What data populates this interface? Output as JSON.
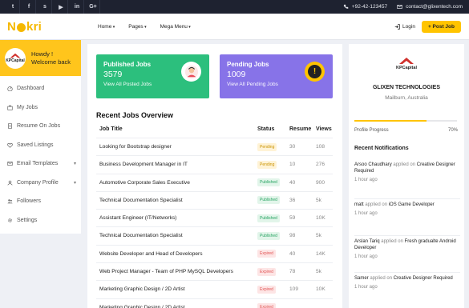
{
  "topbar": {
    "socials": [
      {
        "icon": "twitter-icon",
        "glyph": "t"
      },
      {
        "icon": "facebook-icon",
        "glyph": "f"
      },
      {
        "icon": "skype-icon",
        "glyph": "s"
      },
      {
        "icon": "youtube-icon",
        "glyph": "▶"
      },
      {
        "icon": "linkedin-icon",
        "glyph": "in"
      },
      {
        "icon": "google-plus-icon",
        "glyph": "G+"
      }
    ],
    "phone": "+92-42-123457",
    "email": "contact@glixentech.com"
  },
  "nav": {
    "logo": "Nokri",
    "menu": [
      "Home",
      "Pages",
      "Mega Menu"
    ],
    "login": "Login",
    "post_job": "+ Post Job"
  },
  "sidebar": {
    "greeting_line1": "Howdy !",
    "greeting_line2": "Welcome back",
    "avatar_text": "KPCapital",
    "items": [
      {
        "label": "Dashboard",
        "icon": "speedometer-icon",
        "chevron": ""
      },
      {
        "label": "My Jobs",
        "icon": "briefcase-icon",
        "chevron": ""
      },
      {
        "label": "Resume On Jobs",
        "icon": "document-icon",
        "chevron": ""
      },
      {
        "label": "Saved Listings",
        "icon": "heart-icon",
        "chevron": ""
      },
      {
        "label": "Email Templates",
        "icon": "mail-icon",
        "chevron": "▾"
      },
      {
        "label": "Company Profile",
        "icon": "user-icon",
        "chevron": "▾"
      },
      {
        "label": "Followers",
        "icon": "people-icon",
        "chevron": ""
      },
      {
        "label": "Settings",
        "icon": "gear-icon",
        "chevron": ""
      }
    ]
  },
  "cards": {
    "published": {
      "title": "Published Jobs",
      "value": "3579",
      "link": "View All Posted Jobs"
    },
    "pending": {
      "title": "Pending Jobs",
      "value": "1009",
      "link": "View All Pending Jobs"
    }
  },
  "overview": {
    "title": "Recent Jobs Overview",
    "headers": {
      "title": "Job Title",
      "status": "Status",
      "resume": "Resume",
      "views": "Views"
    },
    "rows": [
      {
        "title": "Looking for Bootstrap designer",
        "status": "Pending",
        "type": "pending",
        "resume": "30",
        "views": "108"
      },
      {
        "title": "Business Development Manager in IT",
        "status": "Pending",
        "type": "pending",
        "resume": "10",
        "views": "276"
      },
      {
        "title": "Automotive Corporate Sales Executive",
        "status": "Published",
        "type": "published",
        "resume": "40",
        "views": "900"
      },
      {
        "title": "Technical Documentation Specialist",
        "status": "Published",
        "type": "published",
        "resume": "36",
        "views": "5k"
      },
      {
        "title": "Assistant Engineer (IT/Networks)",
        "status": "Published",
        "type": "published",
        "resume": "59",
        "views": "10K"
      },
      {
        "title": "Technical Documentation Specialist",
        "status": "Published",
        "type": "published",
        "resume": "98",
        "views": "5k"
      },
      {
        "title": "Website Developer and Head of Developers",
        "status": "Expired",
        "type": "expired",
        "resume": "40",
        "views": "14K"
      },
      {
        "title": "Web Project Manager - Team of PHP MySQL Developers",
        "status": "Expired",
        "type": "expired",
        "resume": "78",
        "views": "5k"
      },
      {
        "title": "Marketing Graphic Design / 2D Artist",
        "status": "Expired",
        "type": "expired",
        "resume": "109",
        "views": "10K"
      },
      {
        "title": "Marketing Graphic Design / 2D Artist",
        "status": "Expired",
        "type": "expired",
        "resume": "",
        "views": ""
      }
    ]
  },
  "company": {
    "logo_text": "KPCapital",
    "name": "GLIXEN TECHNOLOGIES",
    "location": "Mailburn, Australia",
    "progress_label": "Profile Progress",
    "progress_value": "70%",
    "progress_fraction": 0.7
  },
  "notifications": {
    "title": "Recent Notifications",
    "items": [
      {
        "user": "Arsoo Chaudhary",
        "action": "applied on",
        "target": "Creative Designer Required",
        "time": "1 hour ago"
      },
      {
        "user": "matt",
        "action": "applied on",
        "target": "iOS Game Developer",
        "time": "1 hour ago"
      },
      {
        "user": "Arslan Tariq",
        "action": "applied on",
        "target": "Fresh gradualte Android Developer",
        "time": "1 hour ago"
      },
      {
        "user": "Samer",
        "action": "applied on",
        "target": "Creative Designer Required",
        "time": "1 hour ago"
      }
    ]
  },
  "colors": {
    "accent": "#ffc400",
    "green": "#2cbf7d",
    "purple": "#8773e8",
    "topbar": "#1e2230"
  }
}
